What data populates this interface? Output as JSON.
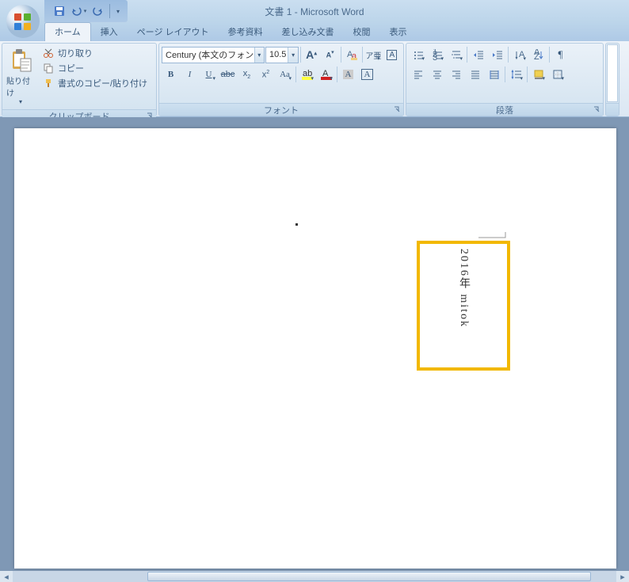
{
  "title": "文書 1 - Microsoft Word",
  "tabs": {
    "home": "ホーム",
    "insert": "挿入",
    "pagelayout": "ページ レイアウト",
    "references": "参考資料",
    "mailings": "差し込み文書",
    "review": "校閲",
    "view": "表示"
  },
  "clipboard": {
    "paste": "貼り付け",
    "cut": "切り取り",
    "copy": "コピー",
    "format_painter": "書式のコピー/貼り付け",
    "group_label": "クリップボード"
  },
  "font": {
    "family": "Century (本文のフォント",
    "size": "10.5",
    "group_label": "フォント"
  },
  "paragraph": {
    "group_label": "段落"
  },
  "document": {
    "textbox_content": "2016年 mitok"
  }
}
